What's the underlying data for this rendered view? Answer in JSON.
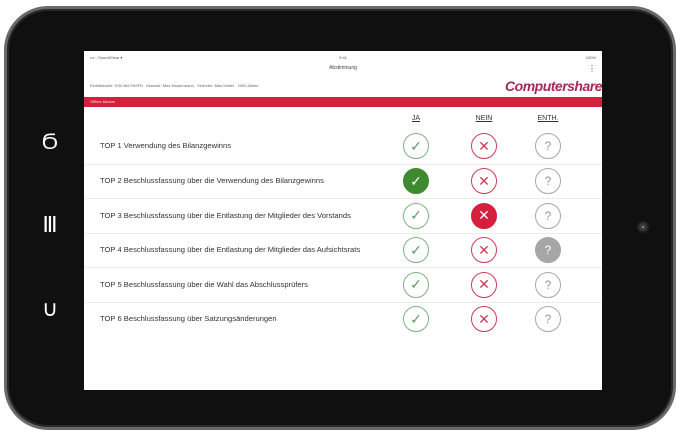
{
  "device": {
    "side_icons": [
      "key-icon",
      "columns-icon",
      "back-icon"
    ],
    "side_glyphs": [
      "Ϭ",
      "Ⅲ",
      "∪"
    ]
  },
  "statusbar": {
    "left": "•••◦◦ SoundClear ▾",
    "time": "9:41",
    "right": "100%"
  },
  "app_title": "Abstimmung",
  "menu_glyph": "⋮",
  "info_text": "Eintrittskarte: 578-084-FA9FN   Aktionär: Max Mustermann   Vertreter: Max Müller   2000 Aktien",
  "logo": "Computershare",
  "mode_label": "Offline-Modus",
  "columns": {
    "ja": "JA",
    "nein": "NEIN",
    "enth": "ENTH."
  },
  "glyphs": {
    "ja": "✓",
    "nein": "✕",
    "enth": "?"
  },
  "colors": {
    "accent_red": "#d61f3d",
    "ja_selected": "#3f8a2e",
    "enth_selected": "#a6a6a6",
    "brand": "#a52a53"
  },
  "agenda": [
    {
      "label": "TOP 1 Verwendung des Bilanzgewinns",
      "selected": ""
    },
    {
      "label": "TOP 2 Beschlussfassung über die Verwendung des Bilanzgewinns",
      "selected": "ja"
    },
    {
      "label": "TOP 3 Beschlussfassung über die Entlastung der Mitglieder des Vorstands",
      "selected": "nein"
    },
    {
      "label": "TOP 4 Beschlussfassung über die Entlastung der Mitglieder das Aufsichtsrats",
      "selected": "enth"
    },
    {
      "label": "TOP 5 Beschlussfassung über die Wahl das Abschlussprüfers",
      "selected": ""
    },
    {
      "label": "TOP 6 Beschlussfassung über Satzungsänderungen",
      "selected": ""
    }
  ]
}
